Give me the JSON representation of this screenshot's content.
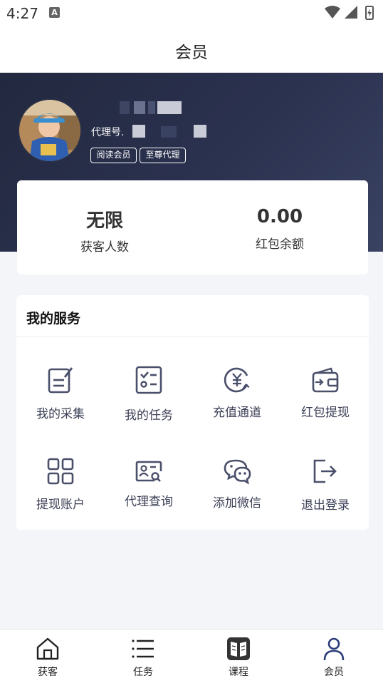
{
  "status_bar": {
    "time": "4:27",
    "notification_icon": "a-icon"
  },
  "header": {
    "title": "会员"
  },
  "profile": {
    "agent_label": "代理号.",
    "badges": [
      "阅读会员",
      "至尊代理"
    ]
  },
  "stats": {
    "customers_value": "无限",
    "customers_label": "获客人数",
    "balance_value": "0.00",
    "balance_label": "红包余额"
  },
  "services": {
    "title": "我的服务",
    "items": [
      {
        "label": "我的采集",
        "icon": "edit-document-icon"
      },
      {
        "label": "我的任务",
        "icon": "task-checklist-icon"
      },
      {
        "label": "充值通道",
        "icon": "yuan-recharge-icon"
      },
      {
        "label": "红包提现",
        "icon": "wallet-icon"
      },
      {
        "label": "提现账户",
        "icon": "grid-icon"
      },
      {
        "label": "代理查询",
        "icon": "id-card-search-icon"
      },
      {
        "label": "添加微信",
        "icon": "wechat-icon"
      },
      {
        "label": "退出登录",
        "icon": "logout-icon"
      }
    ]
  },
  "bottom_nav": {
    "items": [
      {
        "label": "获客",
        "icon": "home-icon"
      },
      {
        "label": "任务",
        "icon": "list-icon"
      },
      {
        "label": "课程",
        "icon": "book-icon"
      },
      {
        "label": "会员",
        "icon": "user-icon"
      }
    ]
  },
  "colors": {
    "header_bg": "#2b3250",
    "icon": "#4a4f6a",
    "page_bg": "#f4f5f9"
  }
}
